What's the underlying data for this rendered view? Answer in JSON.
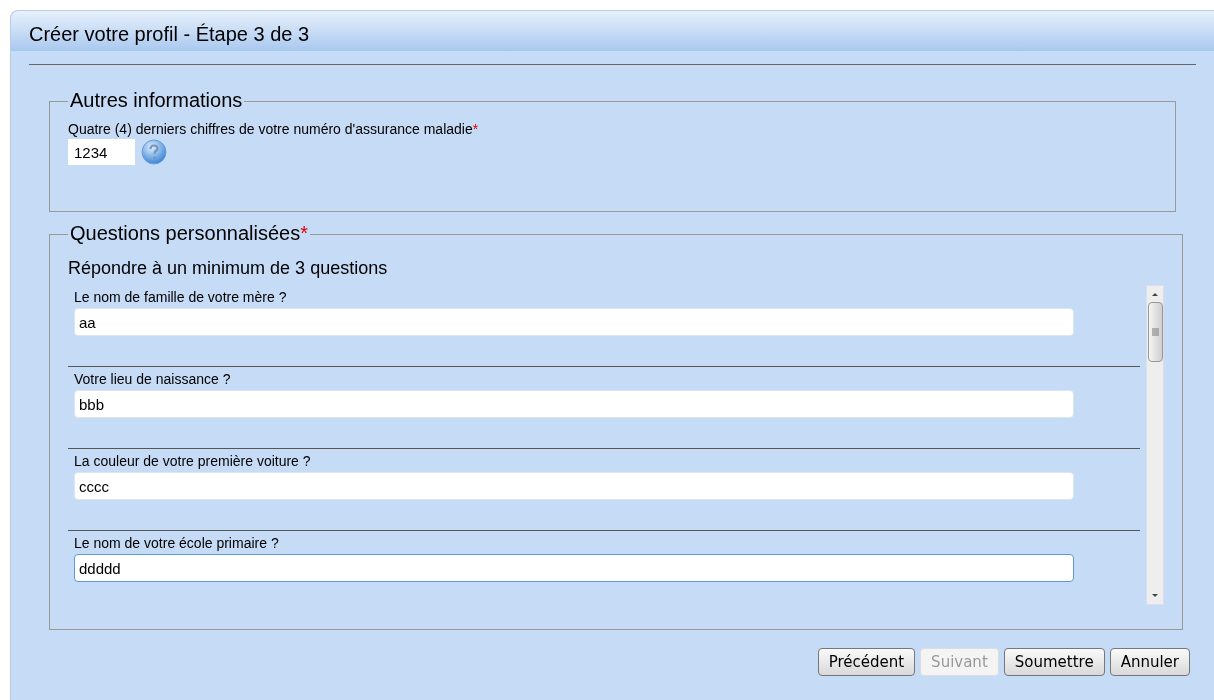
{
  "window": {
    "title": "Créer votre profil - Étape 3 de 3"
  },
  "other_info": {
    "legend": "Autres informations",
    "label": "Quatre (4) derniers chiffres de votre numéro d'assurance maladie",
    "required_mark": "*",
    "value": "1234"
  },
  "questions": {
    "legend": "Questions personnalisées",
    "required_mark": "*",
    "instruction": "Répondre à un minimum de 3 questions",
    "items": [
      {
        "label": "Le nom de famille de votre mère ?",
        "value": "aa",
        "focused": false
      },
      {
        "label": "Votre lieu de naissance ?",
        "value": "bbb",
        "focused": false
      },
      {
        "label": "La couleur de votre première voiture ?",
        "value": "cccc",
        "focused": false
      },
      {
        "label": "Le nom de votre école primaire ?",
        "value": "ddddd",
        "focused": true
      }
    ]
  },
  "buttons": [
    {
      "label": "Précédent",
      "disabled": false
    },
    {
      "label": "Suivant",
      "disabled": true
    },
    {
      "label": "Soumettre",
      "disabled": false
    },
    {
      "label": "Annuler",
      "disabled": false
    }
  ]
}
